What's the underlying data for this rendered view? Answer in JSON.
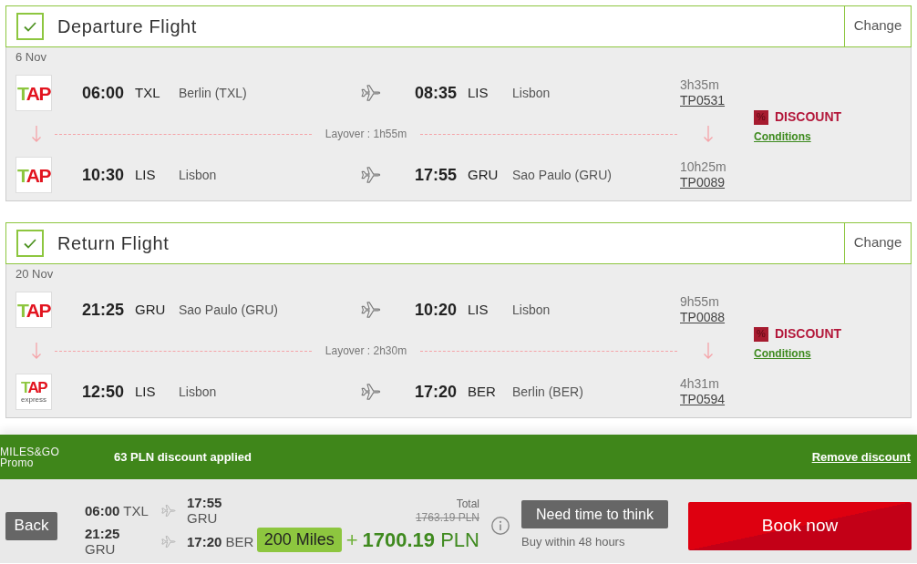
{
  "sections": [
    {
      "title": "Departure Flight",
      "checked": true,
      "change": "Change",
      "date": "6 Nov",
      "segments": [
        {
          "logo": {
            "text": "TAP"
          },
          "depart_time": "06:00",
          "depart_code": "TXL",
          "depart_city": "Berlin (TXL)",
          "arrive_time": "08:35",
          "arrive_code": "LIS",
          "arrive_city": "Lisbon",
          "duration": "3h35m",
          "flight": "TP0531"
        },
        {
          "logo": {
            "text": "TAP"
          },
          "depart_time": "10:30",
          "depart_code": "LIS",
          "depart_city": "Lisbon",
          "arrive_time": "17:55",
          "arrive_code": "GRU",
          "arrive_city": "Sao Paulo (GRU)",
          "duration": "10h25m",
          "flight": "TP0089"
        }
      ],
      "layovers": [
        "Layover : 1h55m"
      ],
      "discount": {
        "icon": "%",
        "label": "DISCOUNT",
        "link": "Conditions"
      }
    },
    {
      "title": "Return Flight",
      "checked": true,
      "change": "Change",
      "date": "20 Nov",
      "segments": [
        {
          "logo": {
            "text": "TAP"
          },
          "depart_time": "21:25",
          "depart_code": "GRU",
          "depart_city": "Sao Paulo (GRU)",
          "arrive_time": "10:20",
          "arrive_code": "LIS",
          "arrive_city": "Lisbon",
          "duration": "9h55m",
          "flight": "TP0088"
        },
        {
          "logo": {
            "text": "TAP",
            "subtitle": "express"
          },
          "depart_time": "12:50",
          "depart_code": "LIS",
          "depart_city": "Lisbon",
          "arrive_time": "17:20",
          "arrive_code": "BER",
          "arrive_city": "Berlin (BER)",
          "duration": "4h31m",
          "flight": "TP0594"
        }
      ],
      "layovers": [
        "Layover : 2h30m"
      ],
      "discount": {
        "icon": "%",
        "label": "DISCOUNT",
        "link": "Conditions"
      }
    }
  ],
  "promo": {
    "brand": "MILES&GO",
    "brand_sub": "Promo",
    "message": "63 PLN discount applied",
    "remove": "Remove discount"
  },
  "footer": {
    "back": "Back",
    "legs": [
      {
        "depart_time": "06:00",
        "depart_code": "TXL",
        "arrive_time": "17:55",
        "arrive_code": "GRU"
      },
      {
        "depart_time": "21:25",
        "depart_code": "GRU",
        "arrive_time": "17:20",
        "arrive_code": "BER"
      }
    ],
    "total_label": "Total",
    "old_price": "1763.19 PLN",
    "miles": "200 Miles",
    "plus": "+",
    "price": "**1700.19** PLN",
    "hold": "Need time to think",
    "hold_note": "Buy within 48 hours",
    "book": "Book now"
  }
}
